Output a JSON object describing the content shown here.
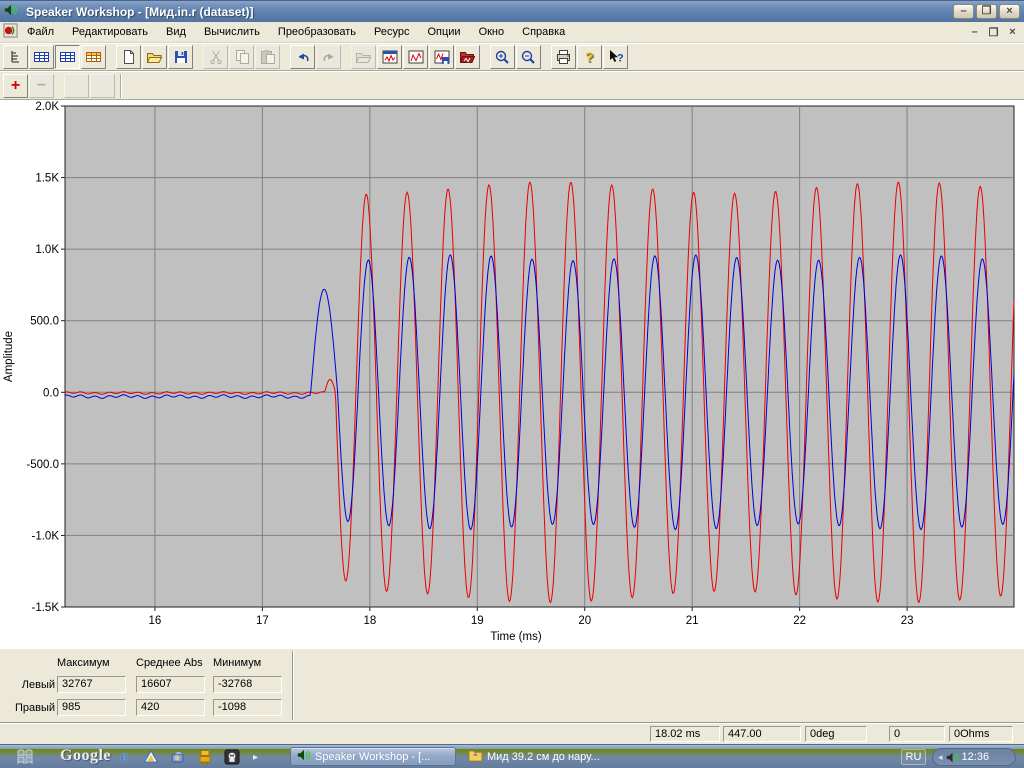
{
  "window": {
    "title": "Speaker Workshop - [Мид.in.r (dataset)]",
    "buttons": {
      "minimize": "–",
      "restore": "❐",
      "close": "×"
    }
  },
  "menubar": {
    "items": [
      "Файл",
      "Редактировать",
      "Вид",
      "Вычислить",
      "Преобразовать",
      "Ресурс",
      "Опции",
      "Окно",
      "Справка"
    ]
  },
  "toolbar": {
    "buttons": [
      {
        "icon": "tree-view",
        "name": "tree-view"
      },
      {
        "icon": "table-blue",
        "name": "datasheet-view"
      },
      {
        "icon": "table-blue",
        "name": "grid-view",
        "pressed": true
      },
      {
        "icon": "table-orange",
        "name": "properties-view"
      },
      "gap",
      {
        "icon": "new-doc",
        "name": "new-document"
      },
      {
        "icon": "open-folder",
        "name": "open"
      },
      {
        "icon": "save",
        "name": "save"
      },
      "gap",
      {
        "icon": "cut",
        "name": "cut",
        "disabled": true
      },
      {
        "icon": "copy",
        "name": "copy",
        "disabled": true
      },
      {
        "icon": "paste",
        "name": "paste",
        "disabled": true
      },
      "gap",
      {
        "icon": "undo",
        "name": "undo"
      },
      {
        "icon": "redo",
        "name": "redo",
        "disabled": true
      },
      "gap",
      {
        "icon": "open-folder",
        "name": "import",
        "disabled": true
      },
      {
        "icon": "chart-window",
        "name": "chart-window"
      },
      {
        "icon": "chart-view",
        "name": "chart-view"
      },
      {
        "icon": "chart-save",
        "name": "chart-save"
      },
      {
        "icon": "chart-export",
        "name": "chart-export"
      },
      "gap",
      {
        "icon": "zoom-in",
        "name": "zoom-in"
      },
      {
        "icon": "zoom-out",
        "name": "zoom-out"
      },
      "gap",
      {
        "icon": "print",
        "name": "print"
      },
      {
        "icon": "help",
        "name": "help"
      },
      {
        "icon": "context-help",
        "name": "context-help"
      }
    ]
  },
  "toolbar2": {
    "buttons": [
      {
        "icon": "plus",
        "name": "add-marker"
      },
      {
        "icon": "minus",
        "name": "remove-marker",
        "disabled": true
      },
      "gap",
      {
        "icon": "blank",
        "name": "blank-1",
        "disabled": true
      },
      {
        "icon": "blank",
        "name": "blank-2",
        "disabled": true
      },
      "sep"
    ]
  },
  "chart_data": {
    "type": "line",
    "title": "",
    "xlabel": "Time (ms)",
    "ylabel": "Amplitude",
    "xlim": [
      15.163,
      23.995
    ],
    "ylim": [
      -1500,
      2000
    ],
    "x_ticks": {
      "values": [
        16,
        17,
        18,
        19,
        20,
        21,
        22,
        23
      ],
      "labels": [
        "16",
        "17",
        "18",
        "19",
        "20",
        "21",
        "22",
        "23"
      ]
    },
    "y_ticks": {
      "values": [
        2000,
        1500,
        1000,
        500,
        0,
        -500,
        -1000,
        -1500
      ],
      "labels": [
        "2.0K",
        "1.5K",
        "1.0K",
        "500.0",
        "0.0",
        "-500.0",
        "-1.0K",
        "-1.5K"
      ]
    },
    "plot_bg": "#c0c0c0",
    "grid_color": "#808080",
    "grid": true,
    "legend": "none",
    "description": "Two tone-burst waveforms, silent until ~17.5 ms then ~2.6 kHz sine: red (left channel) peak ~±1430, blue (right channel) peak ~±950",
    "series": [
      {
        "name": "Левый",
        "name_en": "left-red",
        "color": "#e80000",
        "baseline": -5,
        "noise": 6,
        "onset_ms": 17.58,
        "main_start_ms": 17.68,
        "bump_amp": 90,
        "period_ms": 0.381,
        "steady_amplitude": 1430,
        "amp_wobble": 40,
        "wobble_ref": 18.85,
        "wobble_period": 3.3,
        "ramp_floor": 0.92,
        "ramp_ms": 0.3
      },
      {
        "name": "Правый",
        "name_en": "right-blue",
        "color": "#0000d8",
        "baseline": -30,
        "noise": 8,
        "onset_ms": 17.45,
        "main_start_ms": 17.7,
        "bump_amp": 720,
        "period_ms": 0.381,
        "steady_amplitude": 940,
        "amp_wobble": 20,
        "wobble_ref": 18.3,
        "wobble_period": 2.1,
        "ramp_floor": 0.97,
        "ramp_ms": 0.25
      }
    ]
  },
  "stats_panel": {
    "headers": [
      "Максимум",
      "Среднее Abs",
      "Минимум"
    ],
    "rows": [
      {
        "label": "Левый",
        "values": [
          "32767",
          "16607",
          "-32768"
        ]
      },
      {
        "label": "Правый",
        "values": [
          "985",
          "420",
          "-1098"
        ]
      }
    ]
  },
  "statusbar": {
    "panels": [
      {
        "name": "cursor-time",
        "text": "18.02  ms"
      },
      {
        "name": "cursor-value",
        "text": "447.00"
      },
      {
        "name": "phase",
        "text": "0deg"
      },
      {
        "name": "marker",
        "text": "0"
      },
      {
        "name": "impedance",
        "text": "0Ohms"
      }
    ]
  },
  "taskbar": {
    "google_label": "Google",
    "quick_launch": [
      "ie",
      "delta-app",
      "messenger-app",
      "robot-app",
      "dark-app"
    ],
    "tasks": [
      {
        "label": "Speaker Workshop - [...",
        "icon": "speaker",
        "active": true
      },
      {
        "label": "Мид 39.2 см до нару...",
        "icon": "folder",
        "active": false
      }
    ],
    "tray": {
      "lang": "RU",
      "time": "12:36"
    }
  }
}
